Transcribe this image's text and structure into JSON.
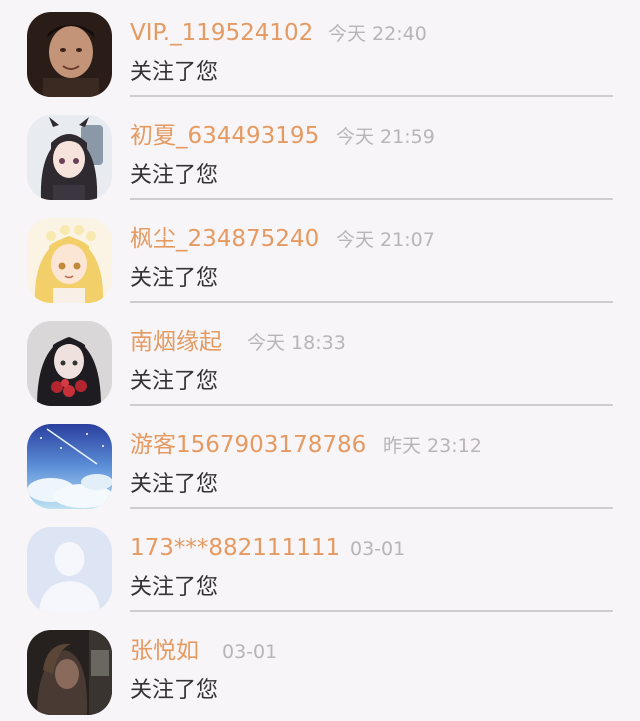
{
  "colors": {
    "name": "#e59a62",
    "time": "#b8b5b8",
    "message": "#333333",
    "divider": "#cfcccf",
    "background": "#f7f5f7"
  },
  "notifications": [
    {
      "name": "VIP._119524102",
      "time": "今天 22:40",
      "message": "关注了您",
      "avatar_icon": "user-photo-avatar"
    },
    {
      "name": "初夏_634493195",
      "time": "今天 21:59",
      "message": "关注了您",
      "avatar_icon": "anime-girl-avatar"
    },
    {
      "name": "枫尘_234875240",
      "time": "今天 21:07",
      "message": "关注了您",
      "avatar_icon": "anime-flower-girl-avatar"
    },
    {
      "name": "南烟缘起",
      "time": "今天 18:33",
      "message": "关注了您",
      "avatar_icon": "anime-character-avatar"
    },
    {
      "name": "游客1567903178786",
      "time": "昨天 23:12",
      "message": "关注了您",
      "avatar_icon": "sky-scenery-avatar"
    },
    {
      "name": "173***882111111",
      "time": "03-01",
      "message": "关注了您",
      "avatar_icon": "default-user-avatar"
    },
    {
      "name": "张悦如",
      "time": "03-01",
      "message": "关注了您",
      "avatar_icon": "dark-photo-avatar"
    }
  ]
}
